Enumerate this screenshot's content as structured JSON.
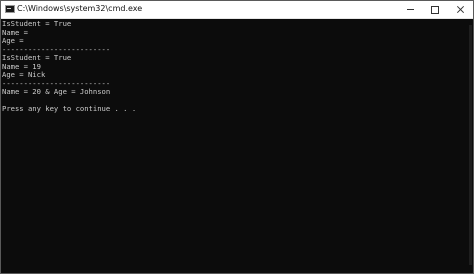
{
  "window": {
    "title": "C:\\Windows\\system32\\cmd.exe",
    "icon": "console-icon",
    "controls": {
      "minimize": "minimize-icon",
      "maximize": "maximize-icon",
      "close": "close-icon"
    }
  },
  "console": {
    "lines": [
      "IsStudent = True",
      "Name =",
      "Age =",
      "-------------------------",
      "IsStudent = True",
      "Name = 19",
      "Age = Nick",
      "-------------------------",
      "Name = 20 & Age = Johnson",
      "",
      "Press any key to continue . . ."
    ]
  },
  "colors": {
    "background": "#0c0c0c",
    "text": "#cccccc",
    "titlebar": "#ffffff"
  }
}
